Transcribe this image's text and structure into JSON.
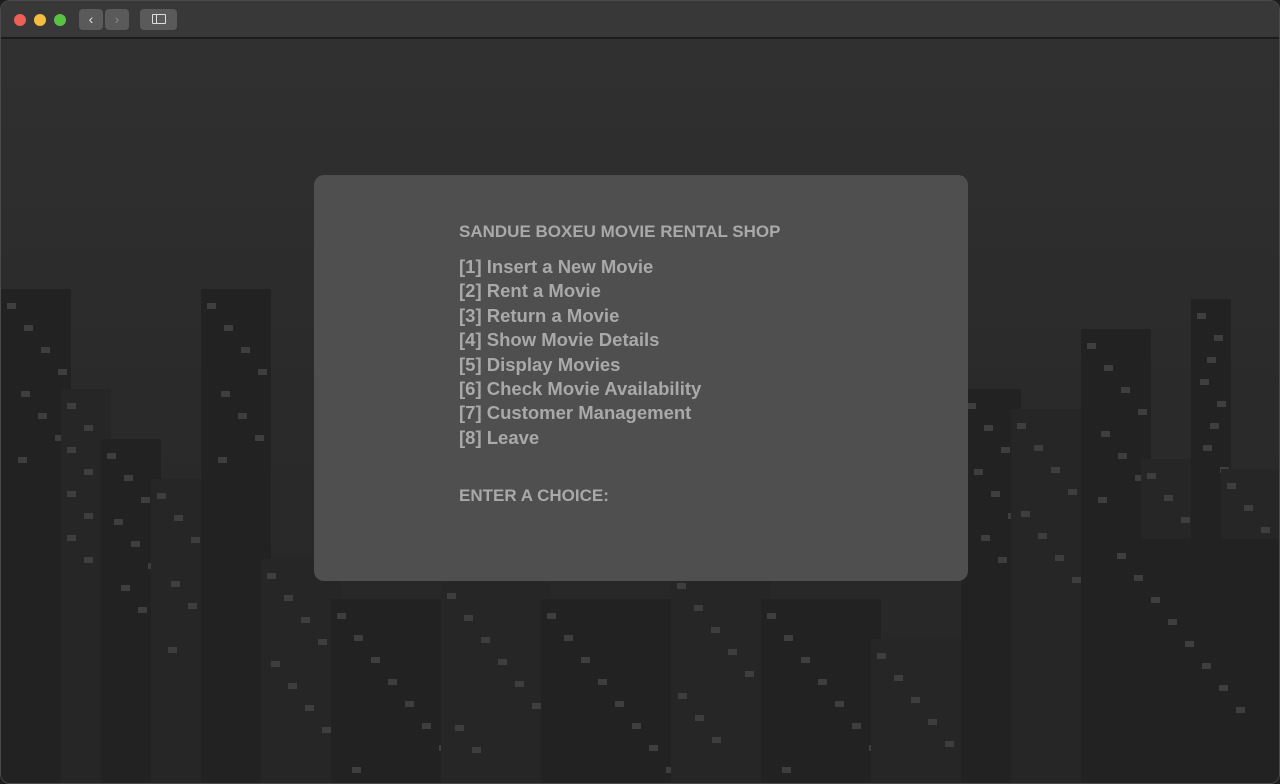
{
  "window": {
    "controls": [
      "close",
      "minimize",
      "zoom"
    ],
    "colors": {
      "close": "#ed5f57",
      "minimize": "#f5bd3f",
      "zoom": "#5ac144"
    },
    "back_icon": "‹",
    "forward_icon": "›"
  },
  "app": {
    "title": "SANDUE BOXEU MOVIE RENTAL SHOP",
    "menu": [
      "[1] Insert a New Movie",
      "[2] Rent a Movie",
      "[3] Return a Movie",
      "[4] Show Movie Details",
      "[5] Display Movies",
      "[6] Check Movie Availability",
      "[7] Customer Management",
      "[8] Leave"
    ],
    "prompt": "ENTER A CHOICE:"
  }
}
